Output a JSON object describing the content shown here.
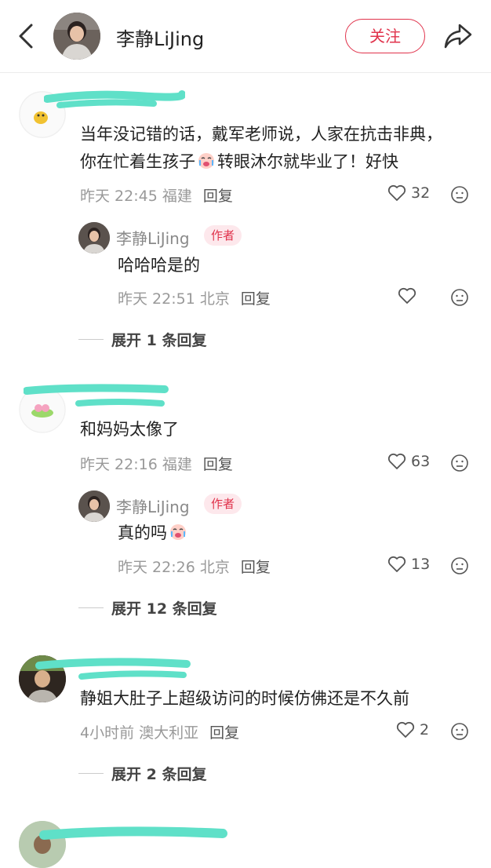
{
  "header": {
    "title": "李静LiJing",
    "follow_label": "关注",
    "back_icon": "chevron-left-icon",
    "share_icon": "share-icon"
  },
  "colors": {
    "accent": "#e0324b",
    "mask": "#5fe0c8"
  },
  "comments": [
    {
      "text_line1": "当年没记错的话，戴军老师说，人家在抗击非典，",
      "text_line2a": "你在忙着生孩子",
      "text_line2b": "转眼沐尔就毕业了！好快",
      "time": "昨天 22:45 福建",
      "reply_label": "回复",
      "likes": "32",
      "reply": {
        "name": "李静LiJing",
        "badge": "作者",
        "text": "哈哈哈是的",
        "time": "昨天 22:51 北京",
        "reply_label": "回复",
        "likes": ""
      },
      "expand": "展开 1 条回复"
    },
    {
      "text": "和妈妈太像了",
      "time": "昨天 22:16 福建",
      "reply_label": "回复",
      "likes": "63",
      "reply": {
        "name": "李静LiJing",
        "badge": "作者",
        "text": "真的吗",
        "time": "昨天 22:26 北京",
        "reply_label": "回复",
        "likes": "13"
      },
      "expand": "展开 12 条回复"
    },
    {
      "text": "静姐大肚子上超级访问的时候仿佛还是不久前",
      "time": "4小时前 澳大利亚",
      "reply_label": "回复",
      "likes": "2",
      "expand": "展开 2 条回复"
    }
  ]
}
